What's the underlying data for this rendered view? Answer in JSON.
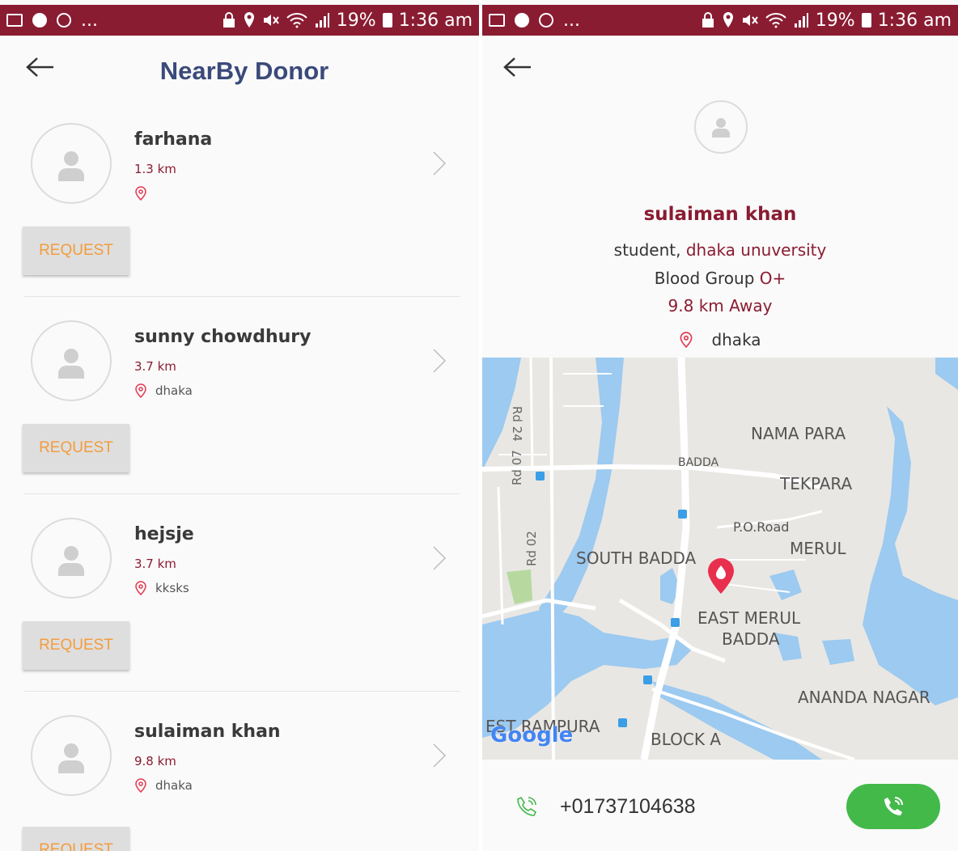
{
  "status_bar": {
    "battery": "19%",
    "time": "1:36 am",
    "more": "..."
  },
  "left_screen": {
    "title": "NearBy Donor",
    "donors": [
      {
        "name": "farhana",
        "distance": "1.3 km",
        "location": "",
        "request_label": "REQUEST"
      },
      {
        "name": "sunny chowdhury",
        "distance": "3.7 km",
        "location": "dhaka",
        "request_label": "REQUEST"
      },
      {
        "name": "hejsje",
        "distance": "3.7 km",
        "location": "kksks",
        "request_label": "REQUEST"
      },
      {
        "name": "sulaiman khan",
        "distance": "9.8 km",
        "location": "dhaka",
        "request_label": "REQUEST"
      }
    ]
  },
  "right_screen": {
    "name": "sulaiman khan",
    "occupation": "student,",
    "institution": "dhaka unuversity",
    "blood_group_label": "Blood Group",
    "blood_group": "O+",
    "distance_away": "9.8 km Away",
    "location": "dhaka",
    "phone": "+01737104638",
    "map": {
      "labels": {
        "rd24": "Rd 24",
        "rd07": "Rd 07",
        "rd02": "Rd 02",
        "badda": "BADDA",
        "nama_para": "NAMA PARA",
        "tekpara": "TEKPARA",
        "po_road": "P.O.Road",
        "merul": "MERUL",
        "south_badda": "SOUTH BADDA",
        "east_merul": "EAST MERUL",
        "east_merul_2": "BADDA",
        "ananda_nagar": "ANANDA NAGAR",
        "west_rampura": "EST RAMPURA",
        "block_a": "BLOCK A",
        "google": "Google"
      }
    }
  },
  "colors": {
    "status_bar": "#8a1c32",
    "title": "#3a4a7a",
    "accent_red": "#8a1c32",
    "request_text": "#f39c3c",
    "call_green": "#43b94a",
    "map_water": "#9ccaf0",
    "map_land": "#e9e7e3"
  },
  "icons": [
    "image-icon",
    "chat-icon",
    "viber-icon",
    "lock-icon",
    "location-icon",
    "mute-icon",
    "wifi-icon",
    "signal-icon",
    "battery-icon",
    "back-arrow-icon",
    "avatar-icon",
    "location-pin-icon",
    "chevron-right-icon",
    "phone-icon",
    "call-icon",
    "map-marker-icon",
    "bus-stop-icon"
  ]
}
